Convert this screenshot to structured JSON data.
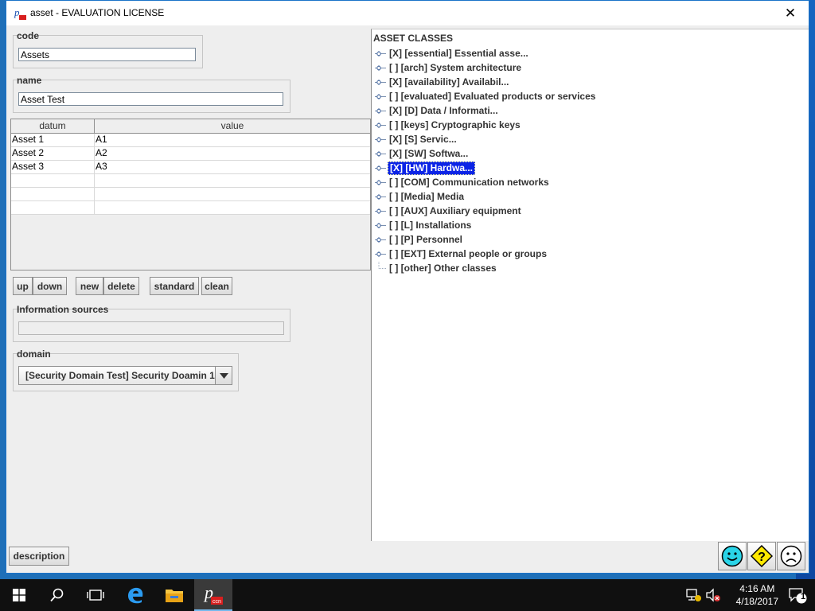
{
  "window": {
    "title": "asset - EVALUATION LICENSE",
    "close_glyph": "✕"
  },
  "form": {
    "code_label": "code",
    "code_value": "Assets",
    "name_label": "name",
    "name_value": "Asset Test",
    "info_label": "Information sources",
    "info_value": "",
    "domain_label": "domain",
    "domain_value": "[Security Domain Test] Security Doamin 1"
  },
  "table": {
    "headers": [
      "datum",
      "value"
    ],
    "rows": [
      [
        "Asset 1",
        "A1"
      ],
      [
        "Asset 2",
        "A2"
      ],
      [
        "Asset 3",
        "A3"
      ],
      [
        "",
        ""
      ],
      [
        "",
        ""
      ],
      [
        "",
        ""
      ]
    ]
  },
  "buttons": {
    "up": "up",
    "down": "down",
    "new": "new",
    "delete": "delete",
    "standard": "standard",
    "clean": "clean",
    "description": "description"
  },
  "tree": {
    "title": "ASSET CLASSES",
    "items": [
      {
        "label": "[X]  [essential] Essential asse...",
        "expandable": true,
        "selected": false
      },
      {
        "label": "[ ]  [arch] System architecture",
        "expandable": true,
        "selected": false
      },
      {
        "label": "[X]  [availability] Availabil...",
        "expandable": true,
        "selected": false
      },
      {
        "label": "[ ]  [evaluated] Evaluated products or services",
        "expandable": true,
        "selected": false
      },
      {
        "label": "[X]  [D] Data / Informati...",
        "expandable": true,
        "selected": false
      },
      {
        "label": "[ ]  [keys] Cryptographic keys",
        "expandable": true,
        "selected": false
      },
      {
        "label": "[X]  [S] Servic...",
        "expandable": true,
        "selected": false
      },
      {
        "label": "[X]  [SW] Softwa...",
        "expandable": true,
        "selected": false
      },
      {
        "label": "[X]  [HW] Hardwa...",
        "expandable": true,
        "selected": true
      },
      {
        "label": "[ ]  [COM] Communication networks",
        "expandable": true,
        "selected": false
      },
      {
        "label": "[ ]  [Media] Media",
        "expandable": true,
        "selected": false
      },
      {
        "label": "[ ]  [AUX] Auxiliary equipment",
        "expandable": true,
        "selected": false
      },
      {
        "label": "[ ]  [L] Installations",
        "expandable": true,
        "selected": false
      },
      {
        "label": "[ ]  [P] Personnel",
        "expandable": true,
        "selected": false
      },
      {
        "label": "[ ]  [EXT] External people or groups",
        "expandable": true,
        "selected": false
      },
      {
        "label": "[ ]  [other] Other classes",
        "expandable": false,
        "selected": false
      }
    ]
  },
  "status_icons": [
    "smiley-happy-icon",
    "help-diamond-icon",
    "smiley-sad-icon"
  ],
  "taskbar": {
    "time": "4:16 AM",
    "date": "4/18/2017",
    "notification_count": "1",
    "app_label": "ccn",
    "icons": [
      "windows-start-icon",
      "search-icon",
      "task-view-icon",
      "edge-icon",
      "file-explorer-icon",
      "pilar-app-icon"
    ]
  },
  "colors": {
    "selection": "#0c24e6",
    "window_border": "#1a73c9",
    "panel_bg": "#eeeeee",
    "smiley": "#2ad4e8",
    "help": "#ffe800"
  }
}
